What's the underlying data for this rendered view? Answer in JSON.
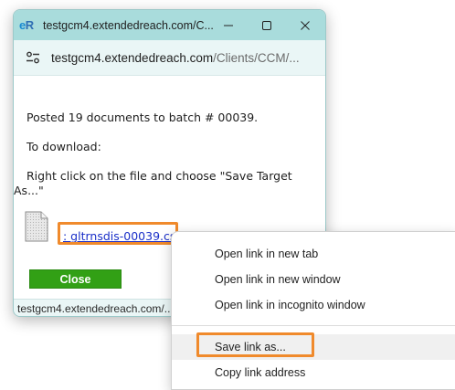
{
  "window": {
    "title": "testgcm4.extendedreach.com/C...",
    "app_icon_text_e": "e",
    "app_icon_text_r": "R"
  },
  "address_bar": {
    "url_host": "testgcm4.extendedreach.com",
    "url_path": "/Clients/CCM/..."
  },
  "content": {
    "posted_message": "Posted 19 documents to batch # 00039.",
    "download_label": "To download:",
    "instruction": "Right click on the file and choose \"Save Target As...\"",
    "file_link": ": gltrnsdis-00039.csv",
    "close_label": "Close"
  },
  "status_bar": {
    "text": "testgcm4.extendedreach.com/..."
  },
  "context_menu": {
    "items": [
      {
        "label": "Open link in new tab"
      },
      {
        "label": "Open link in new window"
      },
      {
        "label": "Open link in incognito window"
      },
      {
        "label": "Save link as..."
      },
      {
        "label": "Copy link address"
      }
    ]
  },
  "colors": {
    "titlebar": "#a9dcdc",
    "highlight": "#f08a2c",
    "close_button": "#32a015",
    "link": "#1a2fc8"
  }
}
